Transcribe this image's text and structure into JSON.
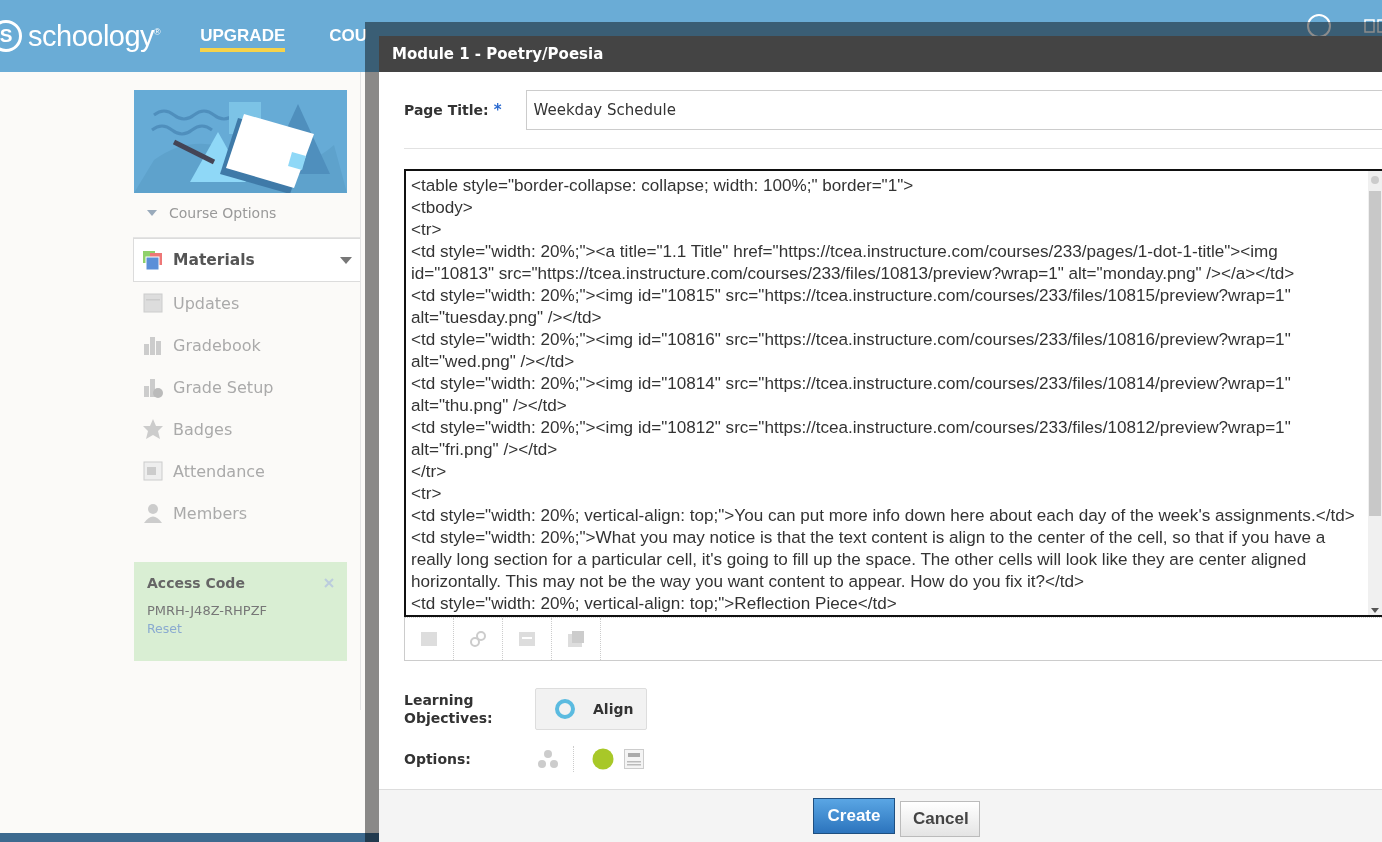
{
  "header": {
    "logo_mark": "S",
    "logo_text": "schoology$^{®}$",
    "upgrade": "UPGRADE",
    "nav": [
      "COU"
    ]
  },
  "sidebar": {
    "course_options": "Course Options",
    "items": [
      {
        "label": "Materials",
        "kind": "materials",
        "selected": true
      },
      {
        "label": "Updates",
        "kind": "updates",
        "selected": false
      },
      {
        "label": "Gradebook",
        "kind": "gradebook",
        "selected": false
      },
      {
        "label": "Grade Setup",
        "kind": "gradesetup",
        "selected": false
      },
      {
        "label": "Badges",
        "kind": "badges",
        "selected": false
      },
      {
        "label": "Attendance",
        "kind": "attendance",
        "selected": false
      },
      {
        "label": "Members",
        "kind": "members",
        "selected": false
      }
    ],
    "access_code": {
      "title": "Access Code",
      "code": "PMRH-J48Z-RHPZF",
      "reset": "Reset"
    }
  },
  "dialog": {
    "title": "Module 1 - Poetry/Poesia",
    "page_title_label": "Page Title:",
    "required_mark": "*",
    "page_title_value": "Weekday Schedule",
    "editor_lines": [
      "<table style=\"border-collapse: collapse; width: 100%;\" border=\"1\">",
      "<tbody>",
      "<tr>",
      "<td style=\"width: 20%;\"><a title=\"1.1 Title\" href=\"https://tcea.instructure.com/courses/233/pages/1-dot-1-title\"><img",
      "id=\"10813\" src=\"https://tcea.instructure.com/courses/233/files/10813/preview?wrap=1\" alt=\"monday.png\" /></a></td>",
      "<td style=\"width: 20%;\"><img id=\"10815\" src=\"https://tcea.instructure.com/courses/233/files/10815/preview?wrap=1\"",
      "alt=\"tuesday.png\" /></td>",
      "<td style=\"width: 20%;\"><img id=\"10816\" src=\"https://tcea.instructure.com/courses/233/files/10816/preview?wrap=1\"",
      "alt=\"wed.png\" /></td>",
      "<td style=\"width: 20%;\"><img id=\"10814\" src=\"https://tcea.instructure.com/courses/233/files/10814/preview?wrap=1\"",
      "alt=\"thu.png\" /></td>",
      "<td style=\"width: 20%;\"><img id=\"10812\" src=\"https://tcea.instructure.com/courses/233/files/10812/preview?wrap=1\"",
      "alt=\"fri.png\" /></td>",
      "</tr>",
      "<tr>",
      "<td style=\"width: 20%; vertical-align: top;\">You can put more info down here about each day of the week's assignments.</td>",
      "<td style=\"width: 20%;\">What you may notice is that the text content is align to the center of the cell, so that if you have a",
      "really long section for a particular cell, it's going to fill up the space. The other cells will look like they are center aligned",
      "horizontally. This may not be the way you want content to appear. How do you fix it?</td>",
      "<td style=\"width: 20%; vertical-align: top;\">Reflection Piece</td>"
    ],
    "learning_objectives_label": "Learning Objectives:",
    "align_button": "Align",
    "options_label": "Options:",
    "buttons": [
      {
        "label": "Create",
        "kind": "primary"
      },
      {
        "label": "Cancel",
        "kind": "secondary"
      }
    ]
  }
}
